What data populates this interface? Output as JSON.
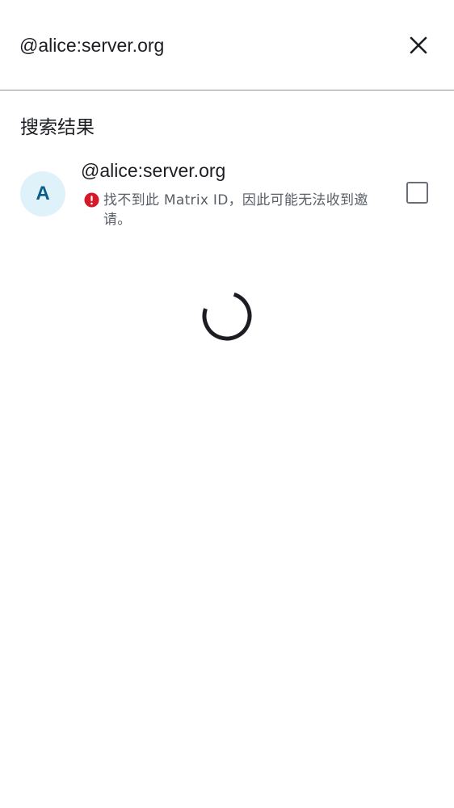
{
  "search": {
    "value": "@alice:server.org",
    "close_icon": "close-icon"
  },
  "results": {
    "section_title": "搜索结果",
    "items": [
      {
        "avatar_letter": "A",
        "user_id": "@alice:server.org",
        "warning_icon": "error-icon",
        "warning": "找不到此 Matrix ID，因此可能无法收到邀请。",
        "checked": false
      }
    ]
  },
  "loading": {
    "icon": "spinner-icon"
  },
  "colors": {
    "avatar_bg": "#e0f2f9",
    "avatar_text": "#0a5c8a",
    "error": "#d51928",
    "divider": "#8e9099"
  }
}
